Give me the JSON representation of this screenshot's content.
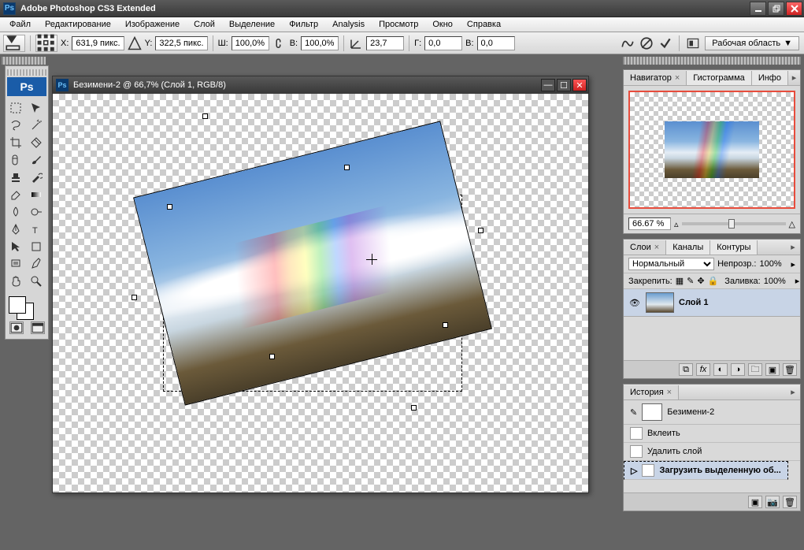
{
  "app": {
    "title": "Adobe Photoshop CS3 Extended"
  },
  "menu": [
    "Файл",
    "Редактирование",
    "Изображение",
    "Слой",
    "Выделение",
    "Фильтр",
    "Analysis",
    "Просмотр",
    "Окно",
    "Справка"
  ],
  "options": {
    "x_label": "X:",
    "x": "631,9 пикс.",
    "y_label": "Y:",
    "y": "322,5 пикс.",
    "w_label": "Ш:",
    "w": "100,0%",
    "h_label": "В:",
    "h": "100,0%",
    "angle": "23,7",
    "hskew_label": "Г:",
    "hskew": "0,0",
    "vskew_label": "В:",
    "vskew": "0,0",
    "workspace": "Рабочая область"
  },
  "doc": {
    "title": "Безимени-2 @ 66,7% (Слой 1, RGB/8)"
  },
  "nav": {
    "tab_navigator": "Навигатор",
    "tab_histogram": "Гистограмма",
    "tab_info": "Инфо",
    "zoom": "66.67 %"
  },
  "layers": {
    "tab_layers": "Слои",
    "tab_channels": "Каналы",
    "tab_paths": "Контуры",
    "blend": "Нормальный",
    "opacity_label": "Непрозр.:",
    "opacity": "100%",
    "lock_label": "Закрепить:",
    "fill_label": "Заливка:",
    "fill": "100%",
    "layer1": "Слой 1"
  },
  "history": {
    "tab": "История",
    "doc": "Безимени-2",
    "items": [
      "Вклеить",
      "Удалить слой",
      "Загрузить выделенную об..."
    ]
  }
}
